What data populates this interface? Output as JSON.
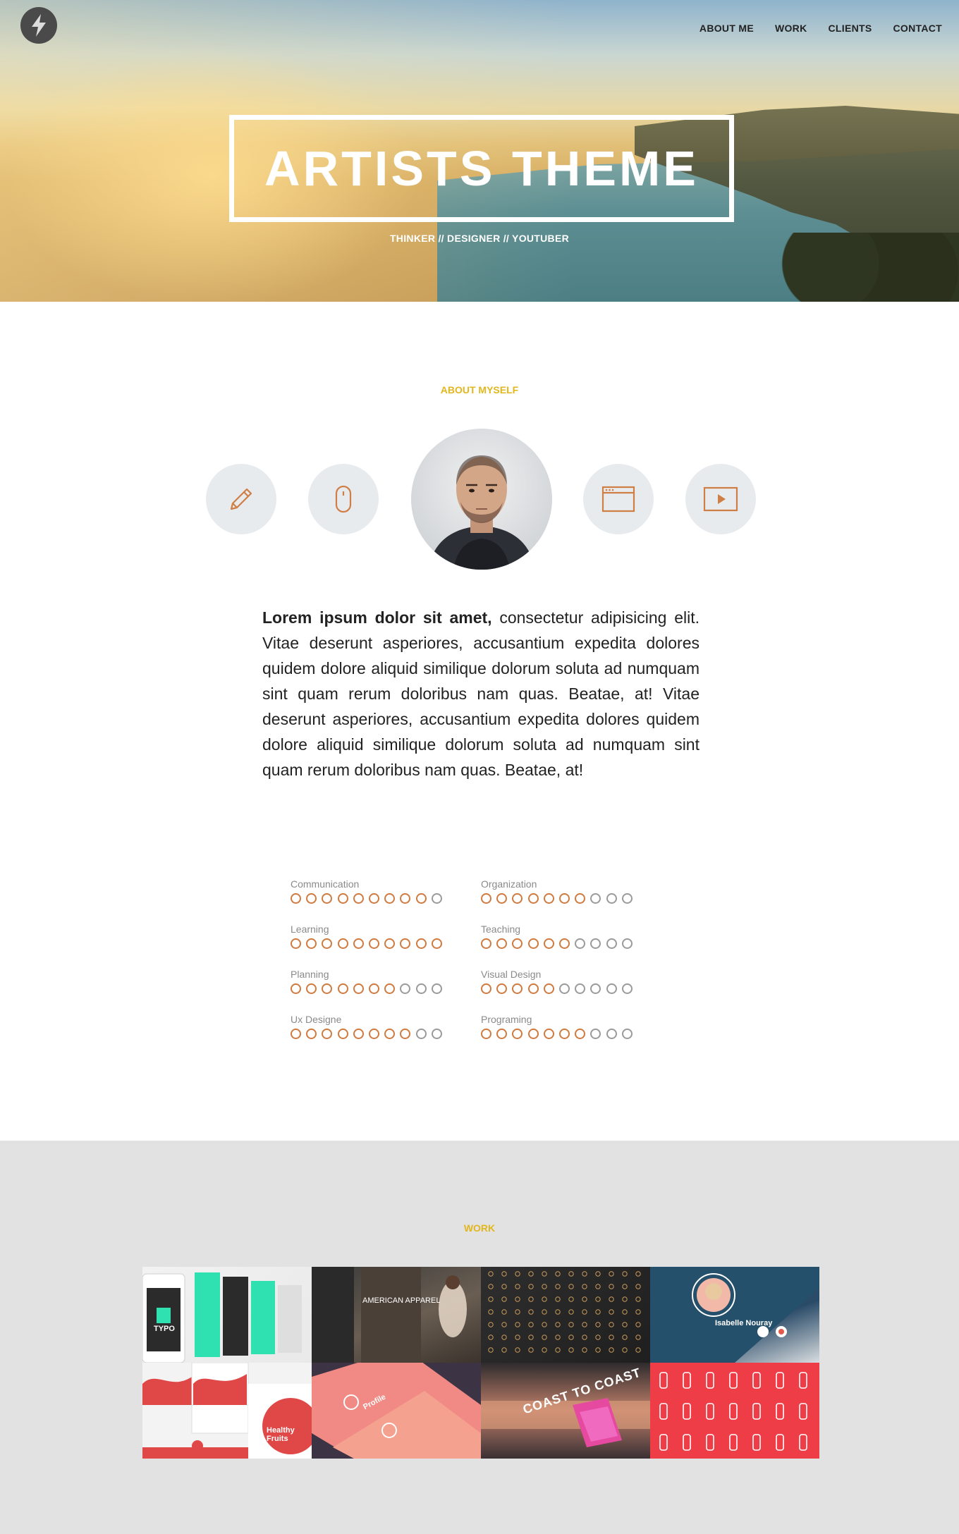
{
  "nav": {
    "items": [
      "ABOUT ME",
      "WORK",
      "CLIENTS",
      "CONTACT"
    ]
  },
  "hero": {
    "title": "ARTISTS THEME",
    "subtitle": "THINKER // DESIGNER // YOUTUBER"
  },
  "about": {
    "label": "ABOUT MYSELF",
    "icons": [
      "pencil-icon",
      "mouse-icon",
      "browser-window-icon",
      "video-play-icon"
    ],
    "text_bold": "Lorem ipsum dolor sit amet,",
    "text_rest": " consectetur adipisicing elit. Vitae deserunt asperiores, accusantium expedita dolores quidem dolore aliquid similique dolorum soluta ad numquam sint quam rerum doloribus nam quas. Beatae, at! Vitae deserunt asperiores, accusantium expedita dolores quidem dolore aliquid similique dolorum soluta ad numquam sint quam rerum doloribus nam quas. Beatae, at!"
  },
  "skills": [
    {
      "name": "Communication",
      "level": 9,
      "max": 10
    },
    {
      "name": "Organization",
      "level": 7,
      "max": 10
    },
    {
      "name": "Learning",
      "level": 10,
      "max": 10
    },
    {
      "name": "Teaching",
      "level": 6,
      "max": 10
    },
    {
      "name": "Planning",
      "level": 7,
      "max": 10
    },
    {
      "name": "Visual Design",
      "level": 5,
      "max": 10
    },
    {
      "name": "Ux Designe",
      "level": 8,
      "max": 10
    },
    {
      "name": "Programing",
      "level": 7,
      "max": 10
    }
  ],
  "colors": {
    "accent": "#e2b71e",
    "dot_on": "#d07a3f",
    "dot_off": "#9a9a9a",
    "work_bg": "#e2e2e2"
  },
  "work": {
    "label": "WORK",
    "tiles": [
      {
        "name": "typo-app-mockup",
        "text": "TYPO"
      },
      {
        "name": "american-apparel-mockup",
        "text": "AMERICAN APPAREL"
      },
      {
        "name": "icon-set-dark",
        "text": ""
      },
      {
        "name": "profile-app-mockup",
        "text": "Isabelle Nouray"
      },
      {
        "name": "charts-app-mockup",
        "text": "Healthy Fruits"
      },
      {
        "name": "profile-map-history-ui",
        "text": "Profile"
      },
      {
        "name": "coast-to-coast-poster",
        "text": "COAST TO COAST"
      },
      {
        "name": "red-icon-set",
        "text": ""
      }
    ]
  }
}
